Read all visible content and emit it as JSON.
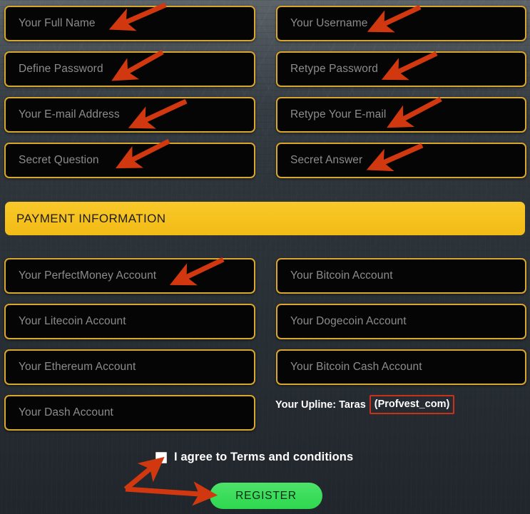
{
  "account_fields": [
    {
      "id": "full-name",
      "placeholder": "Your Full Name",
      "col": "left",
      "row": 0
    },
    {
      "id": "username",
      "placeholder": "Your Username",
      "col": "right",
      "row": 0
    },
    {
      "id": "password",
      "placeholder": "Define Password",
      "col": "left",
      "row": 1
    },
    {
      "id": "retype-password",
      "placeholder": "Retype Password",
      "col": "right",
      "row": 1
    },
    {
      "id": "email",
      "placeholder": "Your E-mail Address",
      "col": "left",
      "row": 2
    },
    {
      "id": "retype-email",
      "placeholder": "Retype Your E-mail",
      "col": "right",
      "row": 2
    },
    {
      "id": "secret-question",
      "placeholder": "Secret Question",
      "col": "left",
      "row": 3
    },
    {
      "id": "secret-answer",
      "placeholder": "Secret Answer",
      "col": "right",
      "row": 3
    }
  ],
  "payment_section": {
    "banner_title": "PAYMENT INFORMATION",
    "banner_color": "#f6c21f",
    "fields": [
      {
        "id": "perfectmoney",
        "placeholder": "Your PerfectMoney Account",
        "col": "left",
        "row": 0
      },
      {
        "id": "bitcoin",
        "placeholder": "Your Bitcoin Account",
        "col": "right",
        "row": 0
      },
      {
        "id": "litecoin",
        "placeholder": "Your Litecoin Account",
        "col": "left",
        "row": 1
      },
      {
        "id": "dogecoin",
        "placeholder": "Your Dogecoin Account",
        "col": "right",
        "row": 1
      },
      {
        "id": "ethereum",
        "placeholder": "Your Ethereum Account",
        "col": "left",
        "row": 2
      },
      {
        "id": "bitcoin-cash",
        "placeholder": "Your Bitcoin Cash Account",
        "col": "right",
        "row": 2
      },
      {
        "id": "dash",
        "placeholder": "Your Dash Account",
        "col": "left",
        "row": 3
      }
    ]
  },
  "upline": {
    "label": "Your Upline: Taras",
    "referral": "(Profvest_com)",
    "highlight_color": "#c8321a"
  },
  "terms": {
    "label": "I agree to Terms and conditions",
    "checked": false
  },
  "submit": {
    "label": "REGISTER",
    "color": "#3ddd5d"
  },
  "theme": {
    "field_border": "#d8a72b",
    "field_background": "#050505",
    "placeholder_color": "#8c8c8c",
    "background": "#2d343a",
    "arrow_color": "#d2380f"
  },
  "annotations": {
    "arrow_color": "#d2380f",
    "arrow_count": 10,
    "description": "Red arrows highlighting form inputs, the terms checkbox and the register button"
  }
}
